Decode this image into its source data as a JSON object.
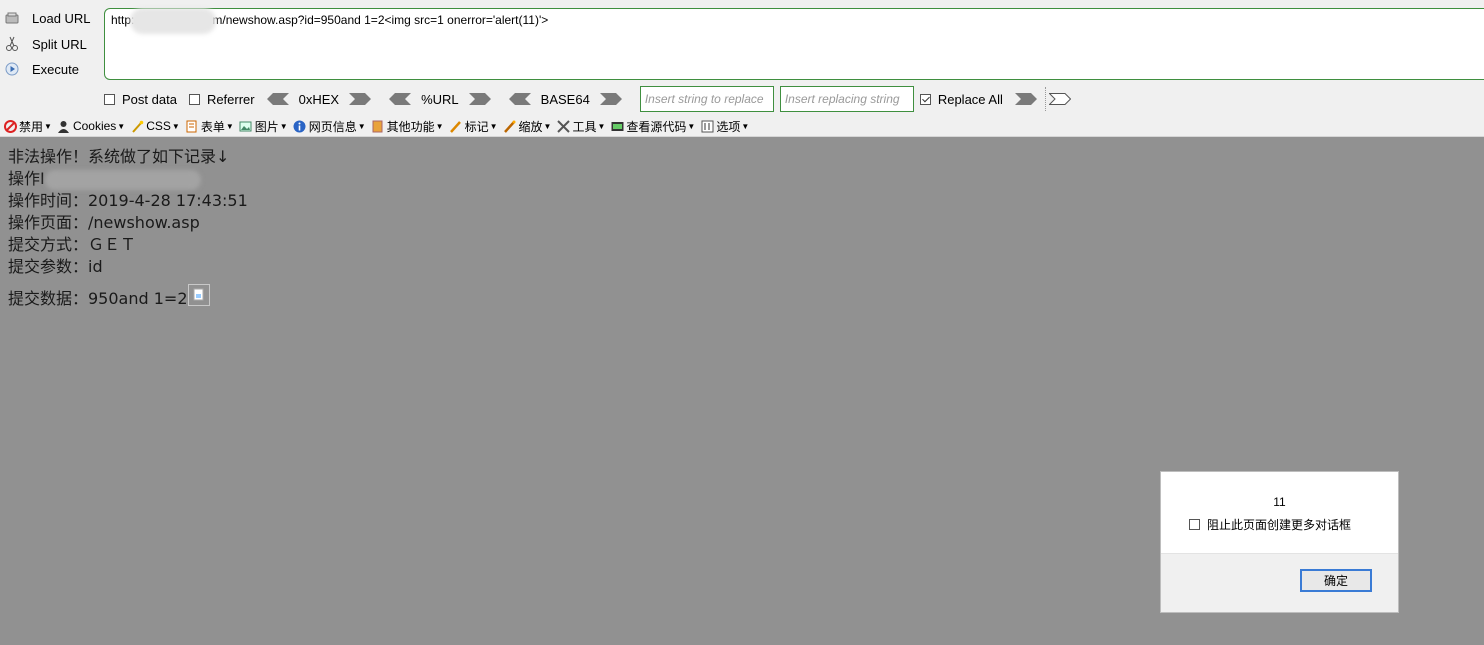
{
  "hackbar": {
    "load_url": "Load URL",
    "split_url": "Split URL",
    "execute": "Execute",
    "url_prefix": "http:",
    "url_suffix": "m/newshow.asp?id=950and 1=2<img src=1 onerror='alert(11)'>",
    "post_data": "Post data",
    "referrer": "Referrer",
    "hex": "0xHEX",
    "url_enc": "%URL",
    "base64": "BASE64",
    "insert_replace_placeholder": "Insert string to replace",
    "insert_replacing_placeholder": "Insert replacing string",
    "replace_all": "Replace All",
    "replace_all_checked": true,
    "accent_color": "#3f8f3f"
  },
  "toolbar": {
    "items": [
      {
        "icon": "block-icon",
        "label": "禁用"
      },
      {
        "icon": "person-icon",
        "label": "Cookies"
      },
      {
        "icon": "wand-icon",
        "label": "CSS"
      },
      {
        "icon": "form-icon",
        "label": "表单"
      },
      {
        "icon": "image-icon",
        "label": "图片"
      },
      {
        "icon": "info-icon",
        "label": "网页信息"
      },
      {
        "icon": "folder-icon",
        "label": "其他功能"
      },
      {
        "icon": "pencil-icon",
        "label": "标记"
      },
      {
        "icon": "resize-icon",
        "label": "缩放"
      },
      {
        "icon": "tools-icon",
        "label": "工具"
      },
      {
        "icon": "source-icon",
        "label": "查看源代码"
      },
      {
        "icon": "options-icon",
        "label": "选项"
      }
    ]
  },
  "content": {
    "line1": "非法操作！系统做了如下记录↓",
    "line2_label": "操作I",
    "line3": "操作时间：2019-4-28 17:43:51",
    "line4": "操作页面：/newshow.asp",
    "line5": "提交方式：ＧＥＴ",
    "line6": "提交参数：id",
    "line7": "提交数据：950and 1=2"
  },
  "dialog": {
    "message": "11",
    "checkbox_label": "阻止此页面创建更多对话框",
    "ok": "确定"
  }
}
